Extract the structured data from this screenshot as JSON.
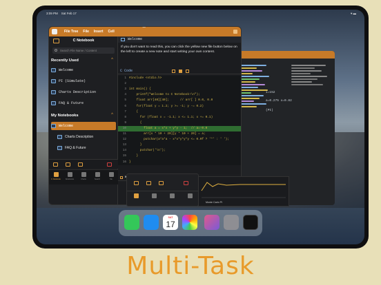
{
  "status": {
    "time": "3:09 PM",
    "date": "Sat Feb 17"
  },
  "menubar": {
    "items": [
      "File Tree",
      "File",
      "Insert",
      "Cell"
    ]
  },
  "sidebar": {
    "title": "C Notebook",
    "search_placeholder": "Search File Name / Content",
    "recent_header": "Recently Used",
    "recent": [
      "Welcome",
      "PI (Simulate)",
      "Charts Description",
      "FAQ & Future"
    ],
    "notebooks_header": "My Notebooks",
    "notebooks": [
      "Welcome",
      "Charts Description",
      "FAQ & Future"
    ]
  },
  "tabbar": {
    "tabs": [
      "C Notebook",
      "Notebooks",
      "Charts",
      "Search",
      "Me"
    ]
  },
  "editor": {
    "file_title": "Welcome",
    "message": "If you don't want to read this, you can click the yellow new file button below on the left to create a new note and start writing your own content.",
    "code_label": "C Code",
    "console": "Welcome to C Notebook!",
    "lines": [
      {
        "n": "1",
        "t": "#include <stdio.h>"
      },
      {
        "n": "2",
        "t": ""
      },
      {
        "n": "3",
        "t": "int main() {"
      },
      {
        "n": "4",
        "t": "    printf(\"Welcome to C Notebook!\\n\");"
      },
      {
        "n": "5",
        "t": "    float arr[40][40];      // arr[ ] 0.0, 0.0"
      },
      {
        "n": "6",
        "t": "    for(float y = 1.2; y >= -1; y -= 0.2)"
      },
      {
        "n": "7",
        "t": "    {"
      },
      {
        "n": "8",
        "t": "      for (float x = -1.1; x <= 1.1; x += 0.1)"
      },
      {
        "n": "9",
        "t": "      {"
      },
      {
        "n": "10",
        "t": "        float a = x*x + y*y - 1;  // a=-0.0"
      },
      {
        "n": "11",
        "t": "        arr[x * 10 + 20][y * 10 + 20] = a;"
      },
      {
        "n": "12",
        "t": "        putchar(a*a*a - x*x*y*y*y <= 0.0f ? '*' : ' ');"
      },
      {
        "n": "13",
        "t": "      }"
      },
      {
        "n": "14",
        "t": "      putchar('\\n');"
      },
      {
        "n": "15",
        "t": "    }"
      },
      {
        "n": "16",
        "t": "}"
      }
    ]
  },
  "back_window": {
    "lines": [
      "i=152",
      "a=0.275 x=0.82",
      "(PI)"
    ]
  },
  "graph": {
    "label": "Monte Carlo PI"
  },
  "dock": {
    "calendar_day": "SAT",
    "calendar_date": "17",
    "apps": [
      "messages",
      "safari",
      "calendar",
      "photos",
      "shortcuts",
      "settings",
      "c-notebook"
    ]
  },
  "caption": "Multi-Task",
  "colors": {
    "accent": "#c77a28",
    "highlight": "#46b446",
    "caption": "#e89a2a"
  }
}
